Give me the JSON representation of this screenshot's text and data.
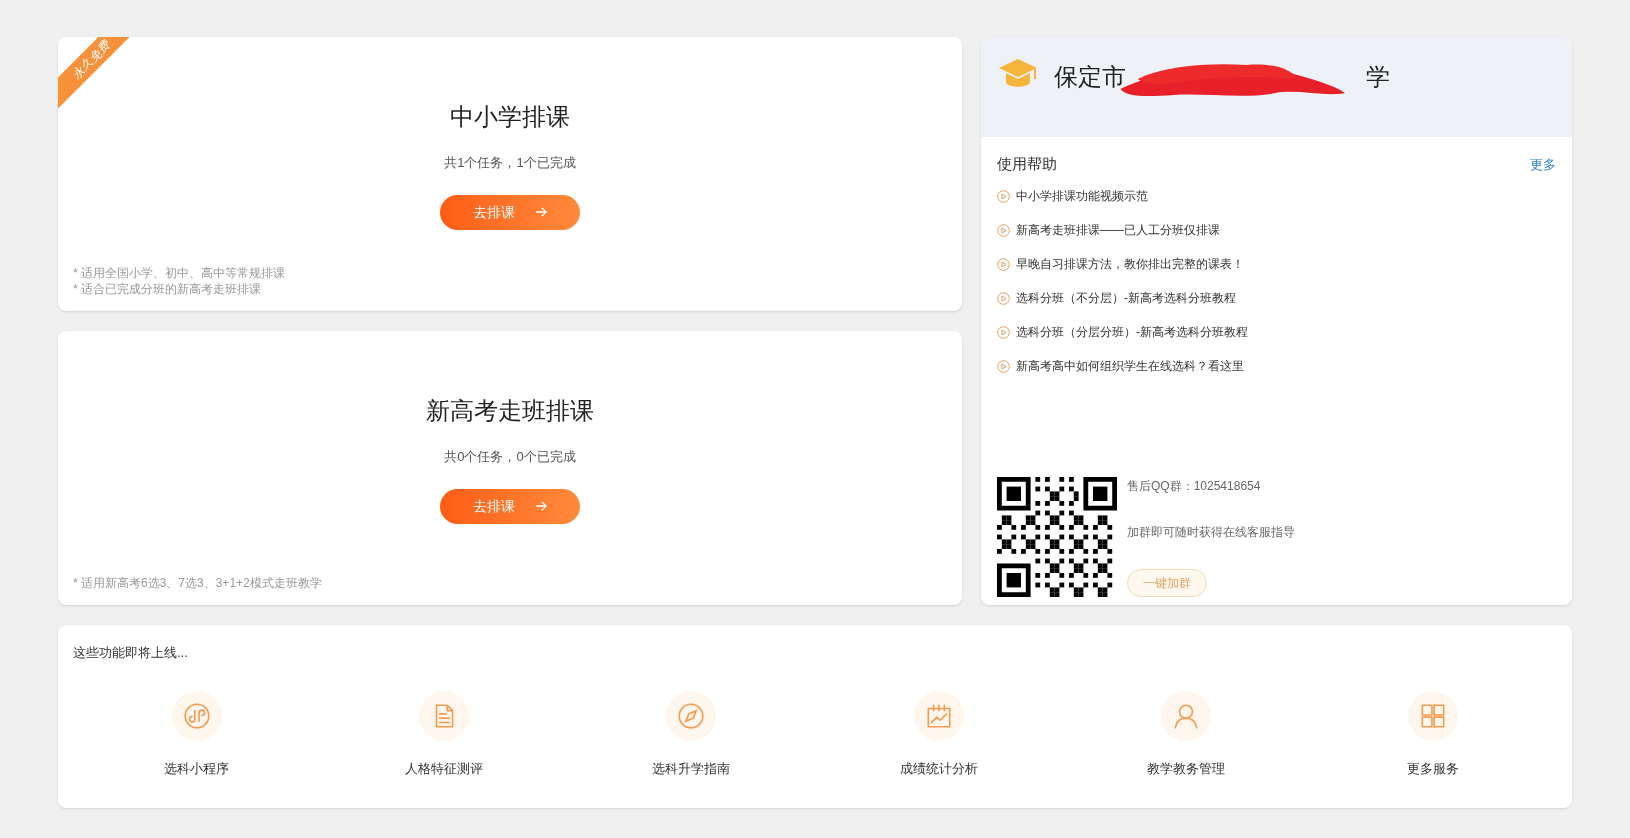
{
  "cards": [
    {
      "ribbon": "永久免费",
      "title": "中小学排课",
      "summary": "共1个任务，1个已完成",
      "button": "去排课",
      "notes": [
        "* 适用全国小学、初中、高中等常规排课",
        "* 适合已完成分班的新高考走班排课"
      ]
    },
    {
      "title": "新高考走班排课",
      "summary": "共0个任务，0个已完成",
      "button": "去排课",
      "notes": [
        "* 适用新高考6选3、7选3、3+1+2模式走班教学"
      ]
    }
  ],
  "school": {
    "title_start": "保定市",
    "title_end": "学"
  },
  "help": {
    "title": "使用帮助",
    "more": "更多",
    "items": [
      "中小学排课功能视频示范",
      "新高考走班排课——已人工分班仅排课",
      "早晚自习排课方法，教你排出完整的课表！",
      "选科分班（不分层）-新高考选科分班教程",
      "选科分班（分层分班）-新高考选科分班教程",
      "新高考高中如何组织学生在线选科？看这里"
    ]
  },
  "support": {
    "group": "售后QQ群：1025418654",
    "hint": "加群即可随时获得在线客服指导",
    "button": "一键加群"
  },
  "upcoming": {
    "title": "这些功能即将上线...",
    "items": [
      {
        "kind": "link",
        "label": "选科小程序"
      },
      {
        "kind": "doc",
        "label": "人格特征测评"
      },
      {
        "kind": "compass",
        "label": "选科升学指南"
      },
      {
        "kind": "chart",
        "label": "成绩统计分析"
      },
      {
        "kind": "user",
        "label": "教学教务管理"
      },
      {
        "kind": "grid",
        "label": "更多服务"
      }
    ]
  }
}
